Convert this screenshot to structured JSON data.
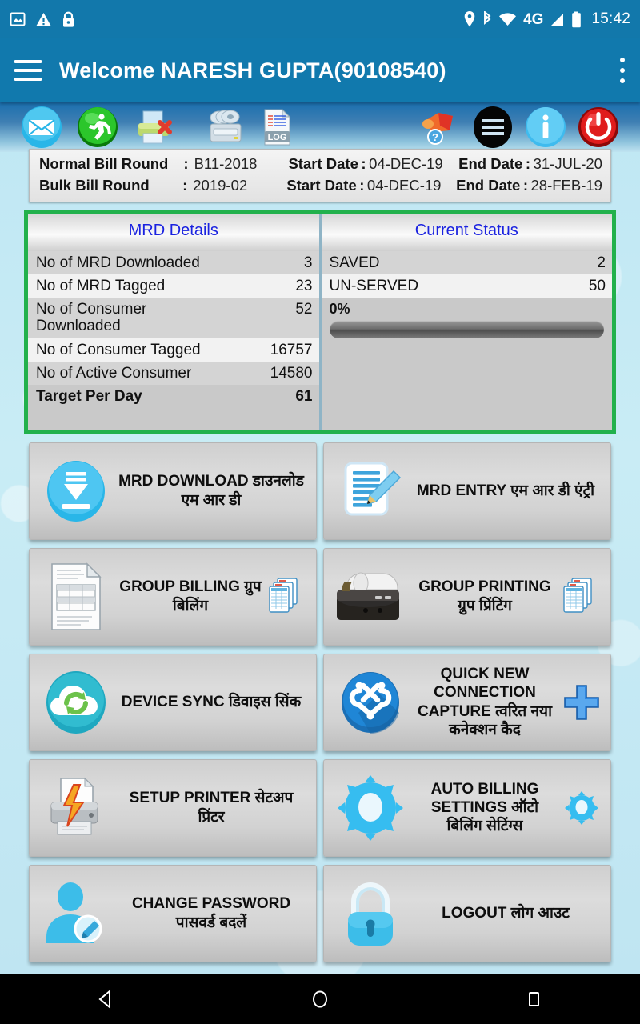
{
  "status_bar": {
    "left_icons": [
      "image-icon",
      "warning-icon",
      "lock-icon"
    ],
    "right_icons": [
      "location-icon",
      "bluetooth-icon",
      "wifi-icon",
      "4g-icon",
      "signal-icon",
      "battery-icon"
    ],
    "network_label": "4G",
    "clock": "15:42"
  },
  "app_bar": {
    "menu_icon": "hamburger-icon",
    "title": "Welcome NARESH GUPTA(90108540)",
    "overflow_icon": "more-vert-icon"
  },
  "toolbar": {
    "left_icons": [
      {
        "name": "mail-icon",
        "label": "Mail"
      },
      {
        "name": "runner-icon",
        "label": "Run"
      },
      {
        "name": "printer-cancel-icon",
        "label": "Printer Cancel"
      },
      {
        "name": "disk-backup-icon",
        "label": "Backup"
      },
      {
        "name": "log-file-icon",
        "label": "LOG"
      }
    ],
    "right_icons": [
      {
        "name": "announcement-help-icon",
        "label": "Announcement"
      },
      {
        "name": "menu-list-icon",
        "label": "List"
      },
      {
        "name": "info-icon",
        "label": "Info"
      },
      {
        "name": "power-icon",
        "label": "Power"
      }
    ]
  },
  "bill_info": {
    "rows": [
      {
        "label": "Normal Bill Round",
        "colon": ":",
        "value": "B11-2018",
        "start_label": "Start Date",
        "start_colon": ":",
        "start_value": "04-DEC-19",
        "end_label": "End Date",
        "end_colon": ":",
        "end_value": "31-JUL-20"
      },
      {
        "label": "Bulk Bill Round",
        "colon": ":",
        "value": "2019-02",
        "start_label": "Start Date",
        "start_colon": ":",
        "start_value": "04-DEC-19",
        "end_label": "End Date",
        "end_colon": ":",
        "end_value": "28-FEB-19"
      }
    ]
  },
  "stats": {
    "highlight_color": "#22b14c",
    "mrd_details": {
      "title": "MRD Details",
      "rows": [
        {
          "key": "No of MRD Downloaded",
          "value": "3"
        },
        {
          "key": "No of MRD Tagged",
          "value": "23"
        },
        {
          "key": "No of Consumer Downloaded",
          "value": "52"
        },
        {
          "key": "No of Consumer Tagged",
          "value": "16757"
        },
        {
          "key": "No of Active Consumer",
          "value": "14580"
        },
        {
          "key": "Target Per Day",
          "value": "61"
        }
      ]
    },
    "current_status": {
      "title": "Current Status",
      "rows": [
        {
          "key": "SAVED",
          "value": "2"
        },
        {
          "key": "UN-SERVED",
          "value": "50"
        }
      ],
      "progress_label": "0%",
      "progress_percent": 0
    }
  },
  "menu_tiles": [
    [
      {
        "icon": "download-circle-icon",
        "label": "MRD DOWNLOAD डाउनलोड एम आर डी",
        "aux_icon": ""
      },
      {
        "icon": "document-pencil-icon",
        "label": "MRD ENTRY एम आर डी एंट्री",
        "aux_icon": ""
      }
    ],
    [
      {
        "icon": "bill-document-icon",
        "label": "GROUP BILLING ग्रुप बिलिंग",
        "aux_icon": "stacked-sheets-icon"
      },
      {
        "icon": "thermal-printer-icon",
        "label": "GROUP PRINTING ग्रुप प्रिंटिंग",
        "aux_icon": "stacked-sheets-icon"
      }
    ],
    [
      {
        "icon": "cloud-sync-icon",
        "label": "DEVICE SYNC डिवाइस सिंक",
        "aux_icon": ""
      },
      {
        "icon": "joomla-connection-icon",
        "label": "QUICK NEW CONNECTION CAPTURE त्वरित नया कनेक्शन कैद",
        "aux_icon": "plus-icon"
      }
    ],
    [
      {
        "icon": "printer-bolt-icon",
        "label": "SETUP PRINTER सेटअप प्रिंटर",
        "aux_icon": ""
      },
      {
        "icon": "gear-icon",
        "label": "AUTO BILLING SETTINGS ऑटो बिलिंग सेटिंग्स",
        "aux_icon": "small-gear-icon"
      }
    ],
    [
      {
        "icon": "user-edit-icon",
        "label": "CHANGE PASSWORD पासवर्ड बदलें",
        "aux_icon": ""
      },
      {
        "icon": "padlock-icon",
        "label": "LOGOUT लोग आउट",
        "aux_icon": ""
      }
    ]
  ],
  "nav_bar": {
    "back": "back-triangle-icon",
    "home": "home-circle-icon",
    "recents": "recents-square-icon"
  }
}
